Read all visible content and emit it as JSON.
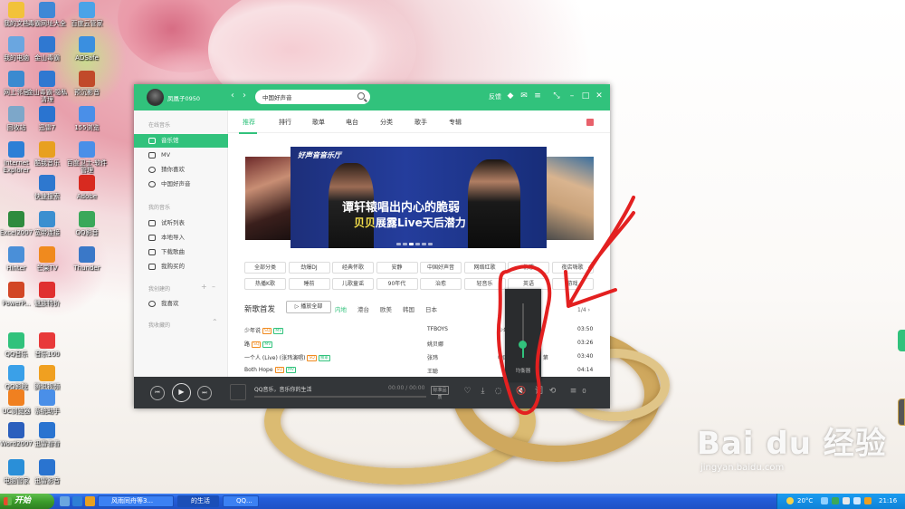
{
  "desktop": {
    "icons": [
      {
        "label": "我的文档",
        "color": "#f2c23a"
      },
      {
        "label": "毒霸网址大全",
        "color": "#3f88d6"
      },
      {
        "label": "百度云管家",
        "color": "#4aa3e8"
      },
      {
        "label": "我的电脑",
        "color": "#6aa6e0"
      },
      {
        "label": "金山毒霸",
        "color": "#2f78d1"
      },
      {
        "label": "ADSafe",
        "color": "#3a8fe0"
      },
      {
        "label": "网上邻居",
        "color": "#3b8ad0"
      },
      {
        "label": "金山毒霸-隐私清理",
        "color": "#2f78d1"
      },
      {
        "label": "预沉影音",
        "color": "#c14a2a"
      },
      {
        "label": "回收站",
        "color": "#7da7c9"
      },
      {
        "label": "迅雷7",
        "color": "#2a74d0"
      },
      {
        "label": "155浏览",
        "color": "#4a8fe8"
      },
      {
        "label": "Internet Explorer",
        "color": "#2d7fd6"
      },
      {
        "label": "酷我音乐",
        "color": "#e8a020"
      },
      {
        "label": "百度卫士-软件管理",
        "color": "#4a8fe8"
      },
      {
        "label": "快速搜索",
        "color": "#2e78cf"
      },
      {
        "label": "Adobe",
        "color": "#d82a20"
      },
      {
        "label": "Excel2007",
        "color": "#2e8b3e"
      },
      {
        "label": "宽带连接",
        "color": "#3c8fd0"
      },
      {
        "label": "QQ影音",
        "color": "#3aa85a"
      },
      {
        "label": "Hinter",
        "color": "#4a8fd8"
      },
      {
        "label": "芒果TV",
        "color": "#f08a1e"
      },
      {
        "label": "Thunder",
        "color": "#3a78c8"
      },
      {
        "label": "PowerP...",
        "color": "#d24726"
      },
      {
        "label": "魅族特价",
        "color": "#e03030"
      },
      {
        "label": "QQ音乐",
        "color": "#31c27c"
      },
      {
        "label": "音乐100",
        "color": "#e83a3a"
      },
      {
        "label": "QQ影院",
        "color": "#3aa0e8"
      },
      {
        "label": "腾讯视频",
        "color": "#f0a020"
      },
      {
        "label": "UC浏览器",
        "color": "#f08020"
      },
      {
        "label": "系统助手",
        "color": "#4a8fe8"
      },
      {
        "label": "Word2007",
        "color": "#2b5fbd"
      },
      {
        "label": "迅雷看看",
        "color": "#2a74d0"
      },
      {
        "label": "电脑管家",
        "color": "#2a8fd8"
      },
      {
        "label": "迅雷影音",
        "color": "#2a74d0"
      }
    ]
  },
  "watermark": {
    "main": "Bai du 经验",
    "url": "jingyan.baidu.com"
  },
  "player": {
    "username": "凤凰子0950",
    "search_value": "中国好声音",
    "top_right": {
      "login_label": "反馈"
    },
    "sidebar": {
      "online_title": "在线音乐",
      "items_online": [
        "音乐馆",
        "MV",
        "猜你喜欢",
        "中国好声音"
      ],
      "mine_title": "我的音乐",
      "items_mine": [
        "试听列表",
        "本地导入",
        "下载歌曲",
        "我购买的"
      ],
      "created_title": "我创建的",
      "items_created": [
        "我喜欢"
      ],
      "collected_title": "我收藏的"
    },
    "tabs": [
      "推荐",
      "排行",
      "歌单",
      "电台",
      "分类",
      "歌手",
      "专辑"
    ],
    "banner": {
      "logo": "好声音音乐厅",
      "line1_highlight": "谭轩辕",
      "line1_rest": "唱出内心的脆弱",
      "line2_highlight": "贝贝",
      "line2_rest": "展露Live天后潜力"
    },
    "chips": [
      "全部分类",
      "劲爆DJ",
      "经典怀歌",
      "安静",
      "中国好声音",
      "网络红歌",
      "伤感",
      "夜店嗨歌",
      "热播K歌",
      "睡前",
      "儿歌童谣",
      "90年代",
      "治愈",
      "轻音乐",
      "英语",
      "游戏"
    ],
    "new_songs": {
      "title": "新歌首发",
      "play_all": "▷ 播放全部",
      "regions": [
        "内地",
        "港台",
        "欧美",
        "韩国",
        "日本"
      ],
      "page": "1/4"
    },
    "songs": [
      {
        "name": "少年说",
        "badges": [
          "SQ",
          "MV"
        ],
        "artist": "TFBOYS",
        "album": "少年说",
        "duration": "03:50"
      },
      {
        "name": "路",
        "badges": [
          "SQ",
          "MV"
        ],
        "artist": "姚贝娜",
        "album": "",
        "duration": "03:26"
      },
      {
        "name": "一个人 (Live) (张玮演唱)",
        "badges": [
          "SQ",
          "独家"
        ],
        "artist": "张玮",
        "album": "中国好声音第四季 第",
        "duration": "03:40"
      },
      {
        "name": "Both Hope",
        "badges": [
          "SQ",
          "MV"
        ],
        "artist": "王聪",
        "album": "",
        "duration": "04:14"
      }
    ],
    "bottom": {
      "now_playing": "QQ音乐，音乐你的生活",
      "time": "00:00 / 00:00",
      "quality": "标准品质",
      "playlist_count": "0"
    },
    "volume": {
      "label": "均衡器",
      "level": 0.25
    }
  },
  "taskbar": {
    "start_label": "开始",
    "tasks": [
      "风雨同舟等3...",
      "的生活",
      "QQ..."
    ],
    "temperature": "20°C",
    "clock": "21:16"
  }
}
